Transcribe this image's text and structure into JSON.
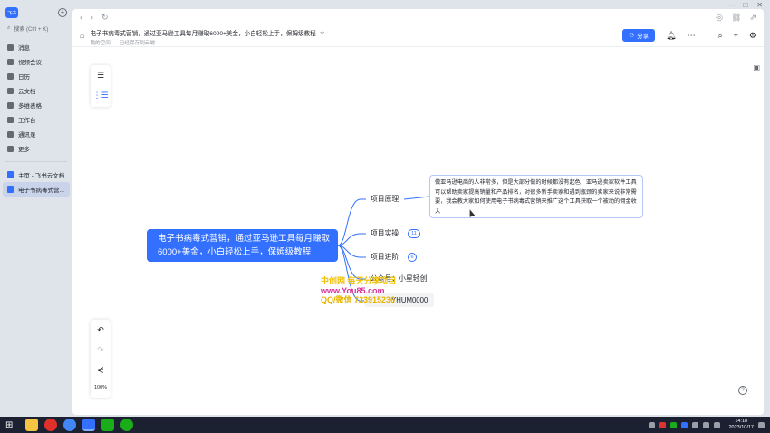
{
  "window": {
    "controls": [
      "—",
      "□",
      "✕"
    ]
  },
  "sidebar": {
    "logo": "飞书",
    "search_placeholder": "搜索 (Ctrl + K)",
    "items": [
      {
        "label": "消息"
      },
      {
        "label": "视频会议"
      },
      {
        "label": "日历"
      },
      {
        "label": "云文档"
      },
      {
        "label": "多维表格"
      },
      {
        "label": "工作台"
      },
      {
        "label": "通讯录"
      },
      {
        "label": "更多"
      }
    ],
    "pinned": [
      {
        "label": "主页 - 飞书云文档"
      },
      {
        "label": "电子书病毒式营..."
      }
    ]
  },
  "toolbar": {
    "back": "‹",
    "forward": "›",
    "refresh": "↻"
  },
  "doc": {
    "title": "电子书病毒式营销，通过亚马逊工具每月赚取6000+美金，小白轻松上手，保姆级教程",
    "location": "我的空间",
    "save_status": "已经保存到云端",
    "share_label": "分享"
  },
  "canvas": {
    "zoom": "100%",
    "root": "电子书病毒式营销，通过亚马逊工具每月赚取6000+美金，小白轻松上手，保姆级教程",
    "branches": [
      {
        "label": "项目原理"
      },
      {
        "label": "项目实操",
        "count": "11"
      },
      {
        "label": "项目进阶",
        "count": "6"
      },
      {
        "label": "公众号：小星轻创"
      },
      {
        "label": "YHUM0000"
      }
    ],
    "note": "做亚马逊电商的人非常多，但是大部分做的时候都没有起色，亚马逊卖家软件工具可以帮助卖家提高销量和产品排名，对很多新手卖家和遇到瓶颈的卖家来说非常需要，我会教大家如何使用电子书病毒式营销来推广这个工具获取一个被动的佣金收入",
    "watermark": [
      "中创网 每天分享项目",
      "www.You85.com",
      "QQ/微信 723915236"
    ]
  },
  "taskbar": {
    "time": "14:18",
    "date": "2023/10/17"
  },
  "colors": {
    "accent": "#3370ff",
    "sidebar_bg": "#dfe3ea",
    "taskbar_bg": "#1b2131"
  }
}
